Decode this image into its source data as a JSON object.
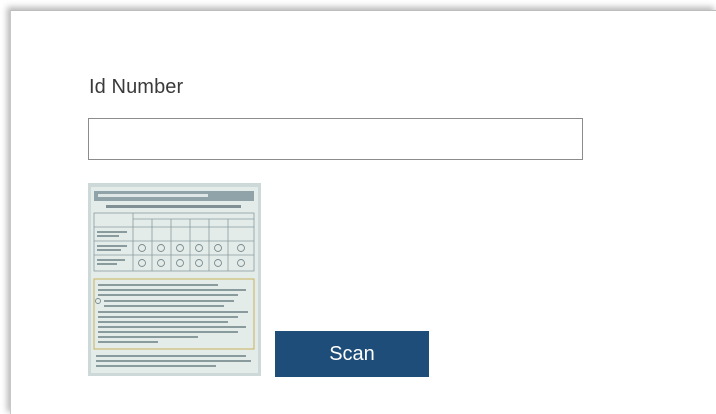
{
  "form": {
    "id_label": "Id Number",
    "id_value": "",
    "id_placeholder": ""
  },
  "scan_preview": {
    "icon": "scanned-document-thumbnail"
  },
  "actions": {
    "scan_label": "Scan"
  },
  "colors": {
    "primary_button": "#1f4d79",
    "button_text": "#ffffff",
    "label_text": "#3a3a3a",
    "input_border": "#8c8c8c"
  }
}
